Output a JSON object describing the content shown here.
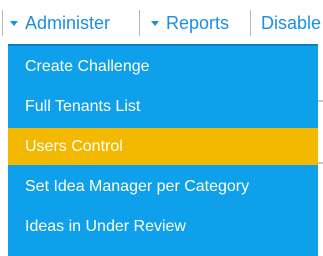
{
  "menubar": {
    "tabs": [
      {
        "label": "Administer",
        "icon": "caret-down-icon"
      },
      {
        "label": "Reports",
        "icon": "caret-down-icon"
      },
      {
        "label": "Disable"
      }
    ],
    "link_color": "#1a8fe3"
  },
  "dropdown": {
    "background_color": "#0ea0ea",
    "highlight_color": "#f2b900",
    "items": [
      {
        "label": "Create Challenge",
        "highlighted": false
      },
      {
        "label": "Full Tenants List",
        "highlighted": false
      },
      {
        "label": "Users Control",
        "highlighted": true
      },
      {
        "label": "Set Idea Manager per Category",
        "highlighted": false
      },
      {
        "label": "Ideas in Under Review",
        "highlighted": false
      }
    ]
  }
}
